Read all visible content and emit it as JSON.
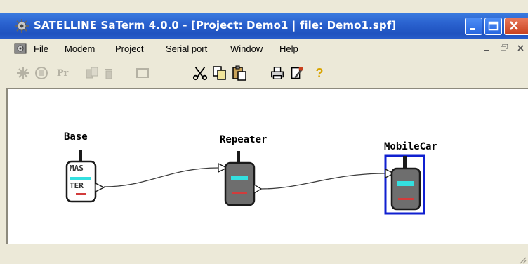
{
  "window": {
    "title": "SATELLINE SaTerm 4.0.0 - [Project: Demo1 | file: Demo1.spf]"
  },
  "menubar": {
    "items": [
      "File",
      "Modem",
      "Project",
      "Serial port",
      "Window",
      "Help"
    ],
    "mdi_controls": [
      "_",
      "̅",
      "×"
    ]
  },
  "toolbar": {
    "pr_label": "Pr",
    "help_glyph": "?",
    "icons": [
      "new-node-icon",
      "modem-icon",
      "pr-icon",
      "link-icon",
      "trash-icon",
      "frame-icon",
      "cut-icon",
      "copy-icon",
      "paste-icon",
      "print-icon",
      "tools-icon",
      "help-icon"
    ]
  },
  "diagram": {
    "nodes": [
      {
        "name": "Base",
        "type": "master",
        "badge": [
          "MAS",
          "TER"
        ]
      },
      {
        "name": "Repeater",
        "type": "repeater"
      },
      {
        "name": "MobileCar",
        "type": "mobile",
        "selected": true
      }
    ]
  },
  "colors": {
    "title_bar": "#2a62cf",
    "device_body": "#6e6e6e",
    "device_screen": "#34e0e0",
    "selection": "#1020d0",
    "led": "#d23c3c"
  }
}
